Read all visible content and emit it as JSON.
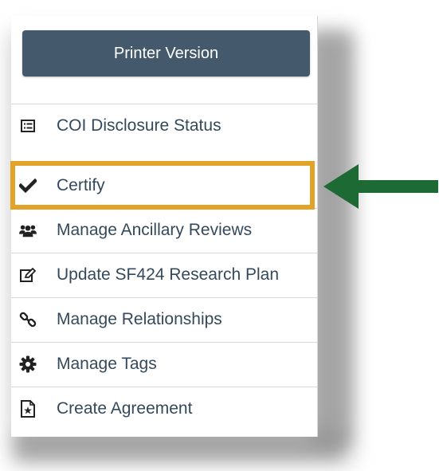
{
  "toolbar": {
    "printer_label": "Printer Version"
  },
  "menu": {
    "items": [
      {
        "label": "COI Disclosure Status",
        "icon": "list-icon"
      },
      {
        "label": "Certify",
        "icon": "checkmark-icon"
      },
      {
        "label": "Manage Ancillary Reviews",
        "icon": "users-icon"
      },
      {
        "label": "Update SF424 Research Plan",
        "icon": "edit-icon"
      },
      {
        "label": "Manage Relationships",
        "icon": "link-icon"
      },
      {
        "label": "Manage Tags",
        "icon": "gear-icon"
      },
      {
        "label": "Create Agreement",
        "icon": "document-star-icon"
      }
    ]
  },
  "colors": {
    "button_bg": "#445a6c",
    "text": "#34495c",
    "highlight": "#e1a429",
    "arrow": "#1e6a35"
  }
}
